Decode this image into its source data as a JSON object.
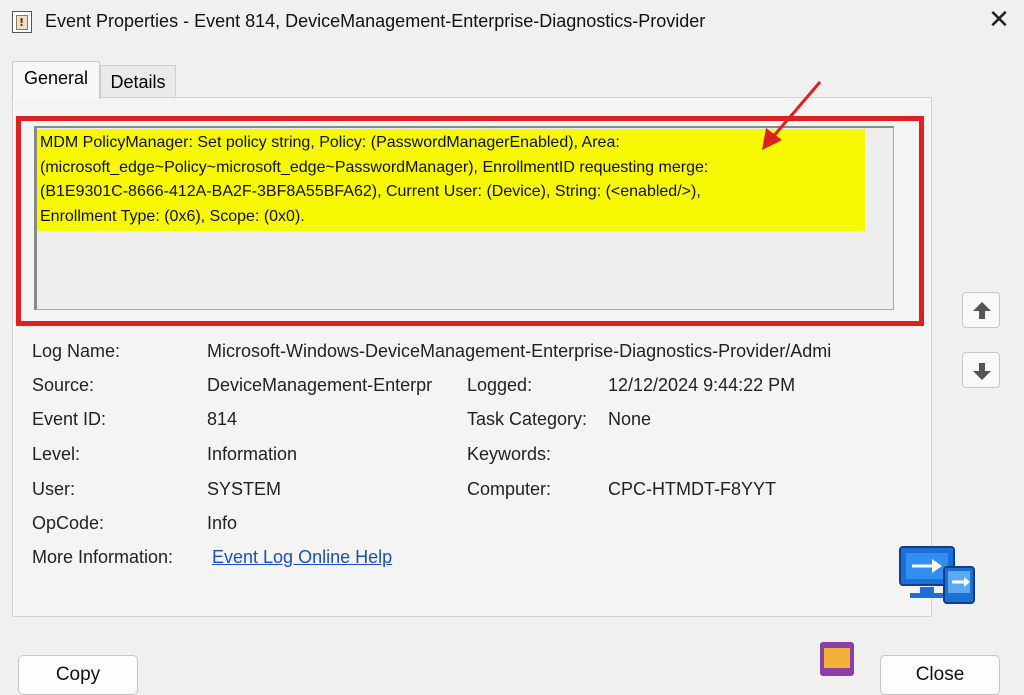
{
  "window": {
    "title": "Event Properties - Event 814, DeviceManagement-Enterprise-Diagnostics-Provider",
    "close_glyph": "✕"
  },
  "tabs": [
    {
      "label": "General",
      "active": true
    },
    {
      "label": "Details",
      "active": false
    }
  ],
  "description": {
    "lines": [
      "MDM PolicyManager: Set policy string, Policy: (PasswordManagerEnabled), Area:",
      "(microsoft_edge~Policy~microsoft_edge~PasswordManager), EnrollmentID requesting merge:",
      "(B1E9301C-8666-412A-BA2F-3BF8A55BFA62), Current User: (Device), String: (<enabled/>),",
      "Enrollment Type: (0x6), Scope: (0x0)."
    ],
    "highlight_color": "#f8f800",
    "annotation_color": "#e02020"
  },
  "fields": {
    "log_name": {
      "label": "Log Name:",
      "value": "Microsoft-Windows-DeviceManagement-Enterprise-Diagnostics-Provider/Admi"
    },
    "source": {
      "label": "Source:",
      "value": "DeviceManagement-Enterpr"
    },
    "logged": {
      "label": "Logged:",
      "value": "12/12/2024 9:44:22 PM"
    },
    "event_id": {
      "label": "Event ID:",
      "value": "814"
    },
    "task_category": {
      "label": "Task Category:",
      "value": "None"
    },
    "level": {
      "label": "Level:",
      "value": "Information"
    },
    "keywords": {
      "label": "Keywords:",
      "value": ""
    },
    "user": {
      "label": "User:",
      "value": "SYSTEM"
    },
    "computer": {
      "label": "Computer:",
      "value": "CPC-HTMDT-F8YYT"
    },
    "opcode": {
      "label": "OpCode:",
      "value": "Info"
    },
    "more_info": {
      "label": "More Information:",
      "value": "Event Log Online Help"
    }
  },
  "buttons": {
    "copy": "Copy",
    "close": "Close"
  },
  "icons": {
    "up": "arrow-up-icon",
    "down": "arrow-down-icon",
    "remote": "remote-desktop-icon",
    "logo": "htmd-logo"
  }
}
